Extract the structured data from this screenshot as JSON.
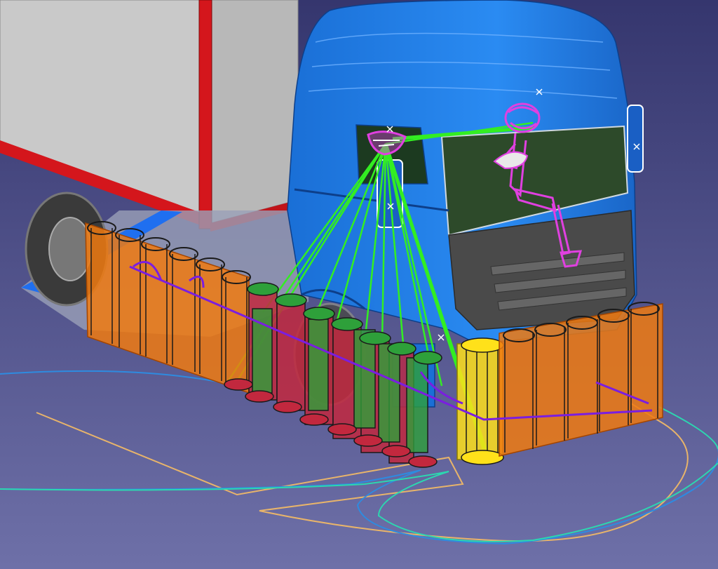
{
  "scene": {
    "subject": "truck-cab-driver-vision-analysis",
    "colors": {
      "background_top": "#35366e",
      "background_bottom": "#6e70a8",
      "trailer_body": "#c9c9c9",
      "trailer_frame": "#d4161c",
      "cab": "#1f7fe6",
      "cab_dark": "#1059b8",
      "cab_glass": "#2d4a2a",
      "grille": "#4a4a4a",
      "driver_manikin": "#e040e0",
      "sight_lines": "#33ee22",
      "cylinder_orange": "#f07a10",
      "cylinder_green": "#2ea03a",
      "cylinder_red": "#c2283e",
      "cylinder_yellow": "#ffe11a",
      "ground_curve_orange": "#e8b46a",
      "ground_curve_blue": "#2e8be0",
      "ground_curve_teal": "#2cd7b0",
      "field_line_purple": "#7a1ee0"
    }
  }
}
